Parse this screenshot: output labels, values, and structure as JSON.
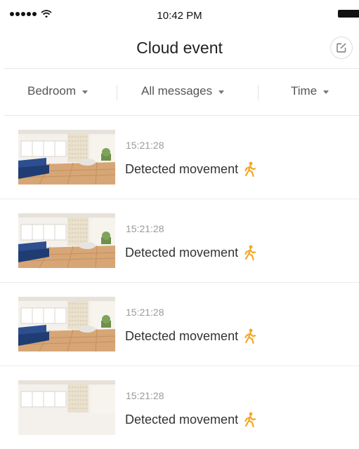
{
  "status_bar": {
    "time": "10:42 PM"
  },
  "nav": {
    "title": "Cloud event"
  },
  "filters": [
    {
      "label": "Bedroom"
    },
    {
      "label": "All messages"
    },
    {
      "label": "Time"
    }
  ],
  "colors": {
    "accent": "#f5a623",
    "divider": "#e8e8e8"
  },
  "events": [
    {
      "time": "15:21:28",
      "text": "Detected movement",
      "icon": "walking-person-icon"
    },
    {
      "time": "15:21:28",
      "text": "Detected movement",
      "icon": "walking-person-icon"
    },
    {
      "time": "15:21:28",
      "text": "Detected movement",
      "icon": "walking-person-icon"
    },
    {
      "time": "15:21:28",
      "text": "Detected movement",
      "icon": "walking-person-icon"
    }
  ]
}
